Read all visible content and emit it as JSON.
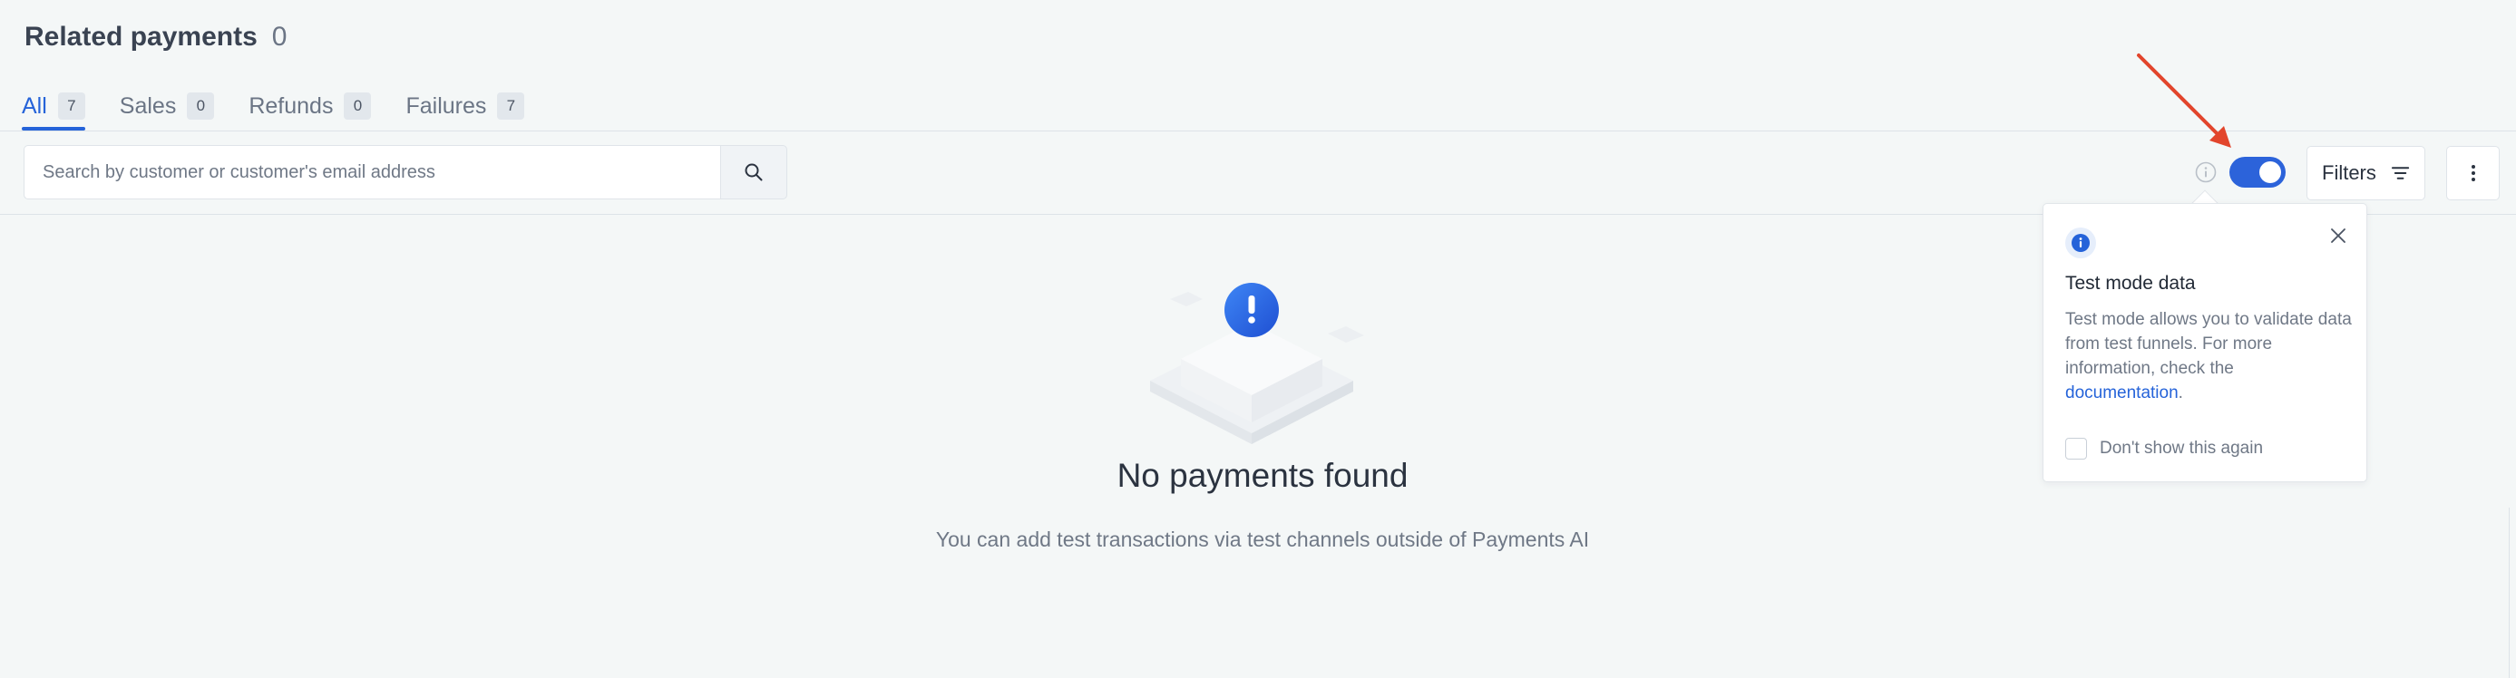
{
  "header": {
    "title": "Related payments",
    "count": "0"
  },
  "tabs": [
    {
      "label": "All",
      "count": "7",
      "active": true
    },
    {
      "label": "Sales",
      "count": "0",
      "active": false
    },
    {
      "label": "Refunds",
      "count": "0",
      "active": false
    },
    {
      "label": "Failures",
      "count": "7",
      "active": false
    }
  ],
  "search": {
    "placeholder": "Search by customer or customer's email address",
    "value": ""
  },
  "toolbar": {
    "filters_label": "Filters",
    "test_mode_toggle": "on"
  },
  "popover": {
    "title": "Test mode data",
    "text": "Test mode allows you to validate data from test funnels. For more information, check the ",
    "link": "documentation",
    "text_end": ".",
    "checkbox_label": "Don't show this again"
  },
  "empty_state": {
    "title": "No payments found",
    "subtitle": "You can add test transactions via test channels outside of Payments AI"
  },
  "colors": {
    "accent": "#2563d9",
    "toggle": "#2c63da",
    "arrow": "#e2452c",
    "background": "#f4f7f7"
  },
  "icons": [
    "search-icon",
    "info-icon",
    "filter-icon",
    "more-vertical-icon",
    "close-icon",
    "alert-icon"
  ]
}
